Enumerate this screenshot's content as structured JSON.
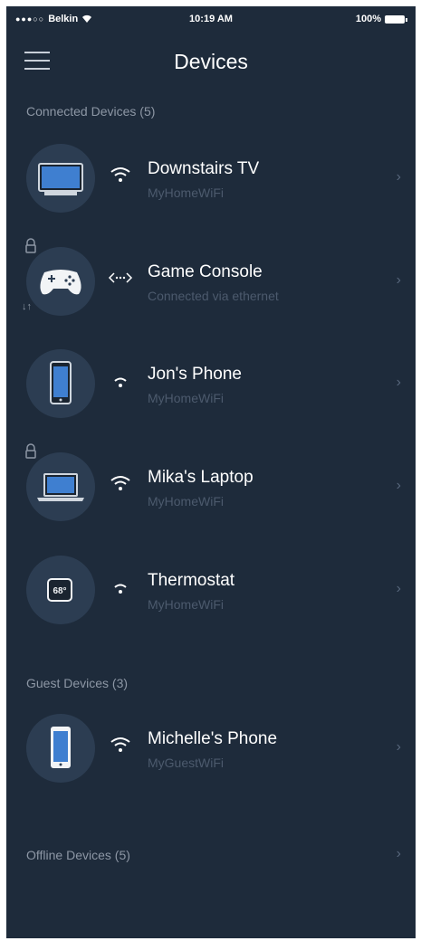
{
  "status_bar": {
    "carrier": "Belkin",
    "time": "10:19 AM",
    "battery": "100%"
  },
  "header": {
    "title": "Devices"
  },
  "connected": {
    "label": "Connected Devices (5)",
    "devices": [
      {
        "name": "Downstairs TV",
        "network": "MyHomeWiFi",
        "icon": "tv-icon",
        "connection": "wifi"
      },
      {
        "name": "Game Console",
        "network": "Connected via ethernet",
        "icon": "gamepad-icon",
        "connection": "ethernet"
      },
      {
        "name": "Jon's Phone",
        "network": "MyHomeWiFi",
        "icon": "phone-icon",
        "connection": "wifi"
      },
      {
        "name": "Mika's Laptop",
        "network": "MyHomeWiFi",
        "icon": "laptop-icon",
        "connection": "wifi"
      },
      {
        "name": "Thermostat",
        "network": "MyHomeWiFi",
        "icon": "thermostat-icon",
        "connection": "wifi",
        "display": "68°"
      }
    ]
  },
  "guest": {
    "label": "Guest Devices (3)",
    "devices": [
      {
        "name": "Michelle's Phone",
        "network": "MyGuestWiFi",
        "icon": "phone-icon",
        "connection": "wifi"
      }
    ]
  },
  "offline": {
    "label": "Offline Devices (5)"
  },
  "colors": {
    "background": "#1e2b3b",
    "avatar": "#2c3d52",
    "accent": "#3f7fd0",
    "muted": "#8d97a5"
  }
}
